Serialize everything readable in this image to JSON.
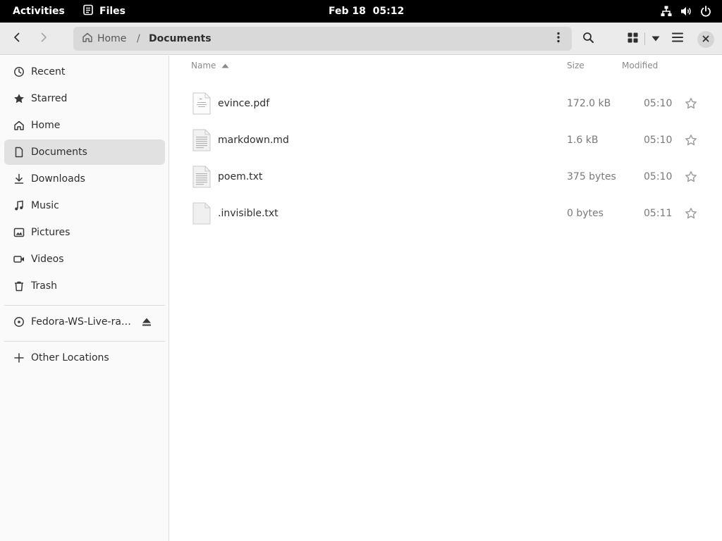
{
  "topbar": {
    "activities": "Activities",
    "app_name": "Files",
    "clock": "Feb 18  05:12",
    "icons": [
      "network-icon",
      "volume-icon",
      "power-icon"
    ]
  },
  "header": {
    "path": {
      "home_label": "Home",
      "separator": "/",
      "current": "Documents"
    },
    "icons": [
      "back-icon",
      "forward-icon",
      "path-menu-icon",
      "search-icon",
      "grid-view-icon",
      "view-options-icon",
      "hamburger-menu-icon",
      "close-icon"
    ]
  },
  "sidebar": {
    "items": [
      {
        "label": "Recent",
        "icon": "clock-icon"
      },
      {
        "label": "Starred",
        "icon": "star-icon"
      },
      {
        "label": "Home",
        "icon": "home-icon"
      },
      {
        "label": "Documents",
        "icon": "document-icon",
        "selected": true
      },
      {
        "label": "Downloads",
        "icon": "download-icon"
      },
      {
        "label": "Music",
        "icon": "music-icon"
      },
      {
        "label": "Pictures",
        "icon": "picture-icon"
      },
      {
        "label": "Videos",
        "icon": "video-icon"
      },
      {
        "label": "Trash",
        "icon": "trash-icon"
      }
    ],
    "devices": [
      {
        "label": "Fedora-WS-Live-ra…",
        "icon": "disc-icon",
        "eject_icon": "eject-icon"
      }
    ],
    "other": {
      "label": "Other Locations",
      "icon": "plus-icon"
    }
  },
  "list": {
    "columns": {
      "name": "Name",
      "size": "Size",
      "modified": "Modified"
    },
    "sort_icon": "sort-ascending-icon",
    "files": [
      {
        "name": "evince.pdf",
        "size": "172.0 kB",
        "modified": "05:10",
        "icon": "pdf-file-icon"
      },
      {
        "name": "markdown.md",
        "size": "1.6 kB",
        "modified": "05:10",
        "icon": "text-file-icon"
      },
      {
        "name": "poem.txt",
        "size": "375 bytes",
        "modified": "05:10",
        "icon": "text-file-icon"
      },
      {
        "name": ".invisible.txt",
        "size": "0 bytes",
        "modified": "05:11",
        "icon": "blank-file-icon"
      }
    ]
  },
  "colors": {
    "topbar_bg": "#000000",
    "headerbar_bg": "#ebebeb",
    "pathbar_bg": "#d9d9d9",
    "sidebar_bg": "#fafafa",
    "sidebar_selected": "#e1e1e1",
    "main_bg": "#ffffff"
  }
}
